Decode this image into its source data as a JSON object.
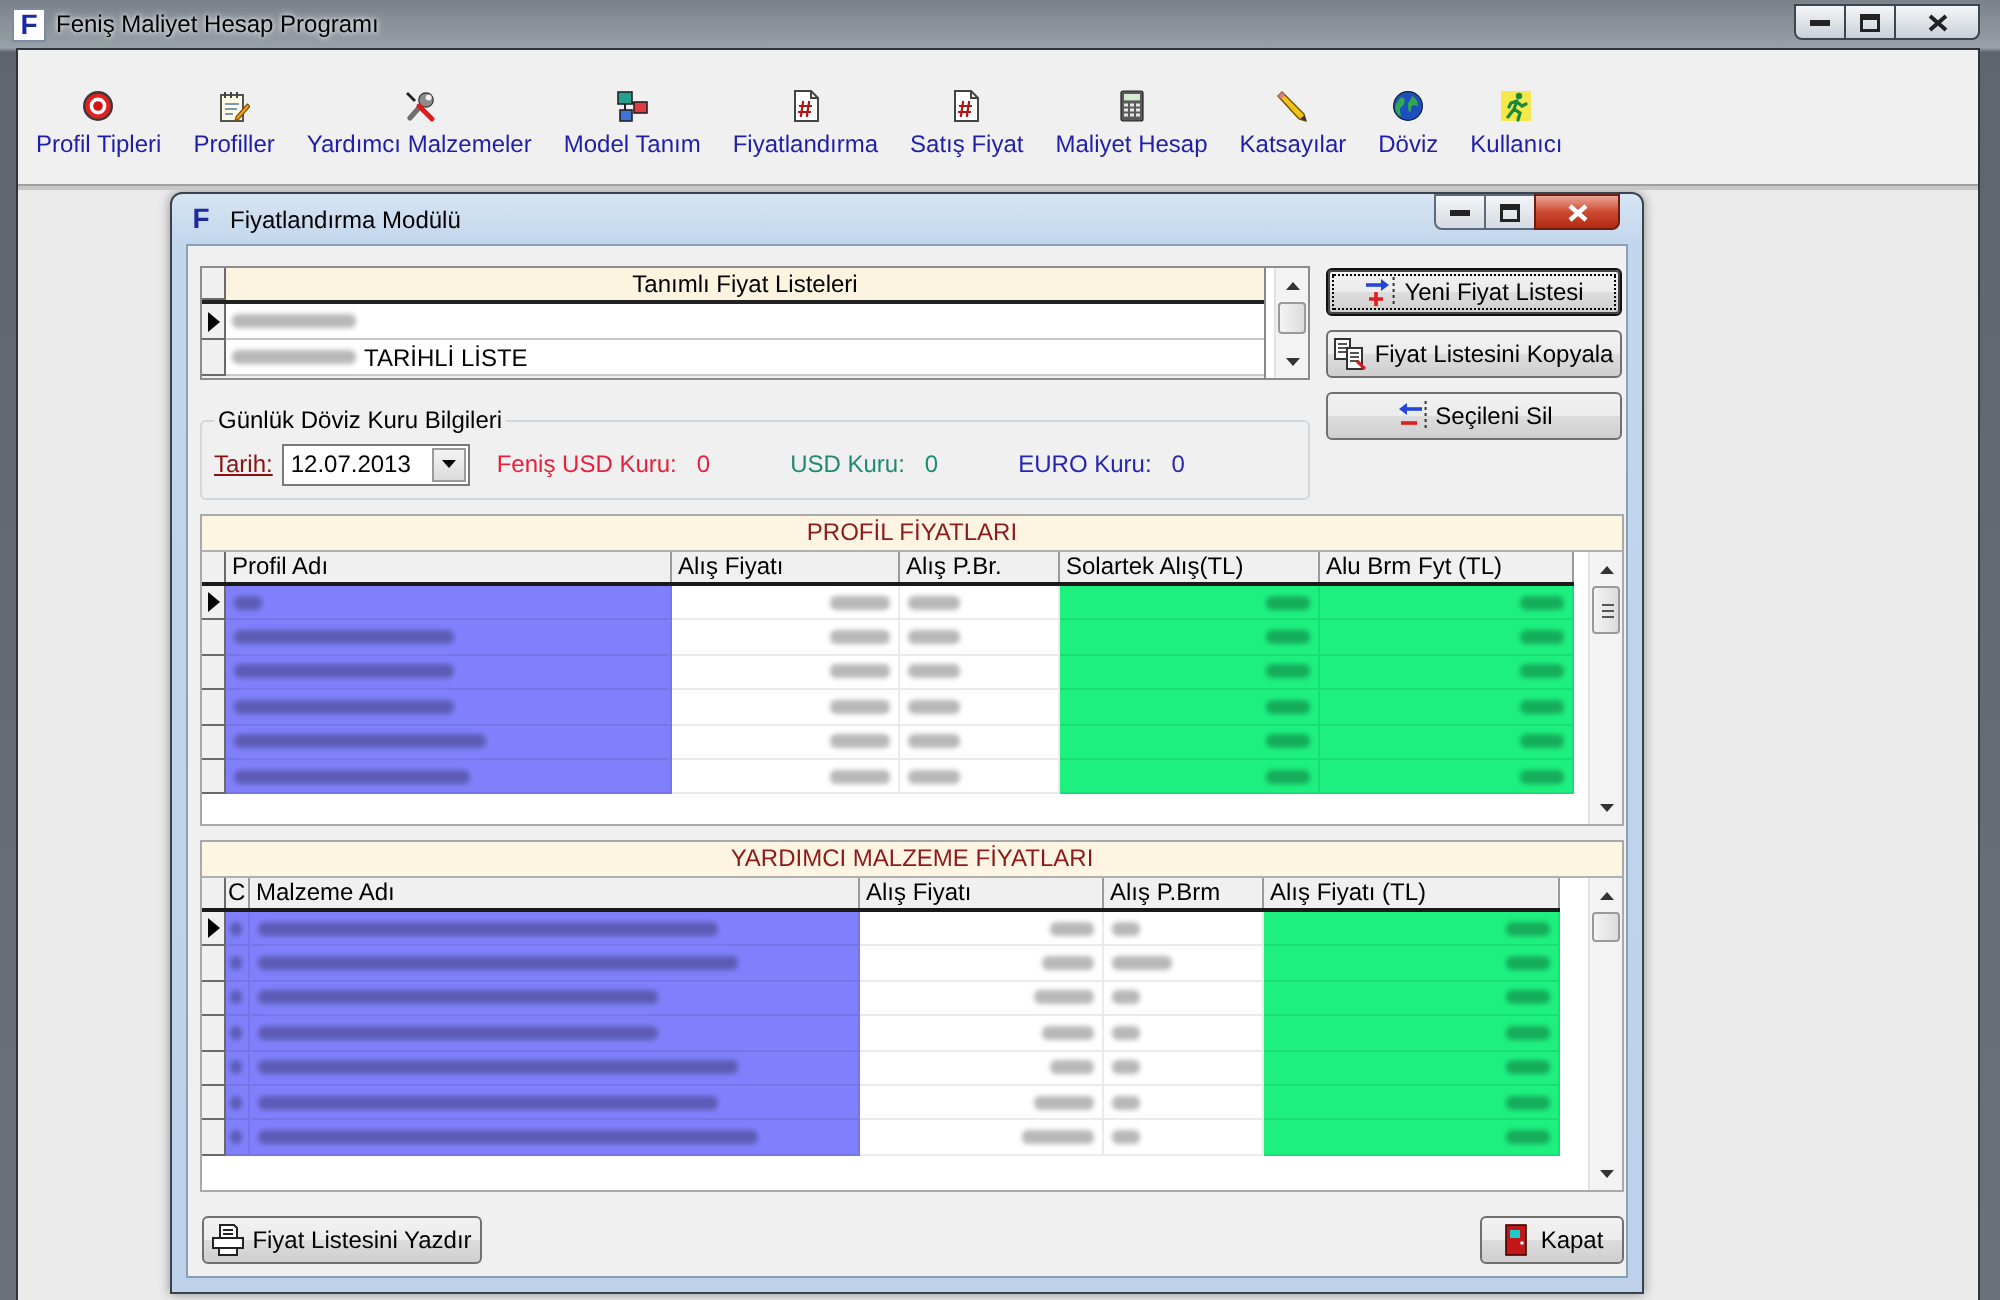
{
  "window": {
    "logo": "F",
    "title": "Feniş Maliyet Hesap Programı"
  },
  "toolbar": [
    "Profil Tipleri",
    "Profiller",
    "Yardımcı Malzemeler",
    "Model Tanım",
    "Fiyatlandırma",
    "Satış Fiyat",
    "Maliyet Hesap",
    "Katsayılar",
    "Döviz",
    "Kullanıcı"
  ],
  "dialog": {
    "logo": "F",
    "title": "Fiyatlandırma Modülü",
    "price_lists": {
      "column": "Tanımlı Fiyat Listeleri",
      "rows": [
        {
          "selected": true
        },
        {
          "label": "TARİHLİ LİSTE",
          "selected": false
        }
      ]
    },
    "actions": [
      {
        "label": "Yeni Fiyat Listesi",
        "focused": true
      },
      {
        "label": "Fiyat Listesini Kopyala",
        "focused": false
      },
      {
        "label": "Seçileni Sil",
        "focused": false
      }
    ],
    "exchange_rates": {
      "title": "Günlük Döviz Kuru Bilgileri",
      "date_label": "Tarih:",
      "date": "12.07.2013",
      "rates": [
        {
          "label": "Feniş USD Kuru:",
          "value": "0",
          "color": "#e8203c"
        },
        {
          "label": "USD Kuru:",
          "value": "0",
          "color": "#1f8a6f"
        },
        {
          "label": "EURO Kuru:",
          "value": "0",
          "color": "#2525b5"
        }
      ]
    },
    "profile_prices": {
      "title": "PROFİL FİYATLARI",
      "columns": [
        {
          "label": "Profil Adı",
          "color": "#8080fc"
        },
        {
          "label": "Alış Fiyatı",
          "color": "#ffffff"
        },
        {
          "label": "Alış P.Br.",
          "color": "#ffffff"
        },
        {
          "label": "Solartek Alış(TL)",
          "color": "#1ef07f"
        },
        {
          "label": "Alu Brm Fyt (TL)",
          "color": "#1ef07f"
        }
      ],
      "rows": [
        {
          "selected": true
        },
        {
          "selected": false
        },
        {
          "selected": false
        },
        {
          "selected": false
        },
        {
          "selected": false
        },
        {
          "selected": false
        }
      ]
    },
    "material_prices": {
      "title": "YARDIMCI MALZEME FİYATLARI",
      "columns": [
        {
          "label": "C",
          "color": "#8080fc"
        },
        {
          "label": "Malzeme Adı",
          "color": "#8080fc"
        },
        {
          "label": "Alış Fiyatı",
          "color": "#ffffff"
        },
        {
          "label": "Alış P.Brm",
          "color": "#ffffff"
        },
        {
          "label": "Alış Fiyatı (TL)",
          "color": "#1ef07f"
        }
      ],
      "rows": [
        {
          "selected": true
        },
        {
          "selected": false
        },
        {
          "selected": false
        },
        {
          "selected": false
        },
        {
          "selected": false
        },
        {
          "selected": false
        },
        {
          "selected": false
        }
      ]
    },
    "print_button": "Fiyat Listesini Yazdır",
    "close_button": "Kapat"
  }
}
